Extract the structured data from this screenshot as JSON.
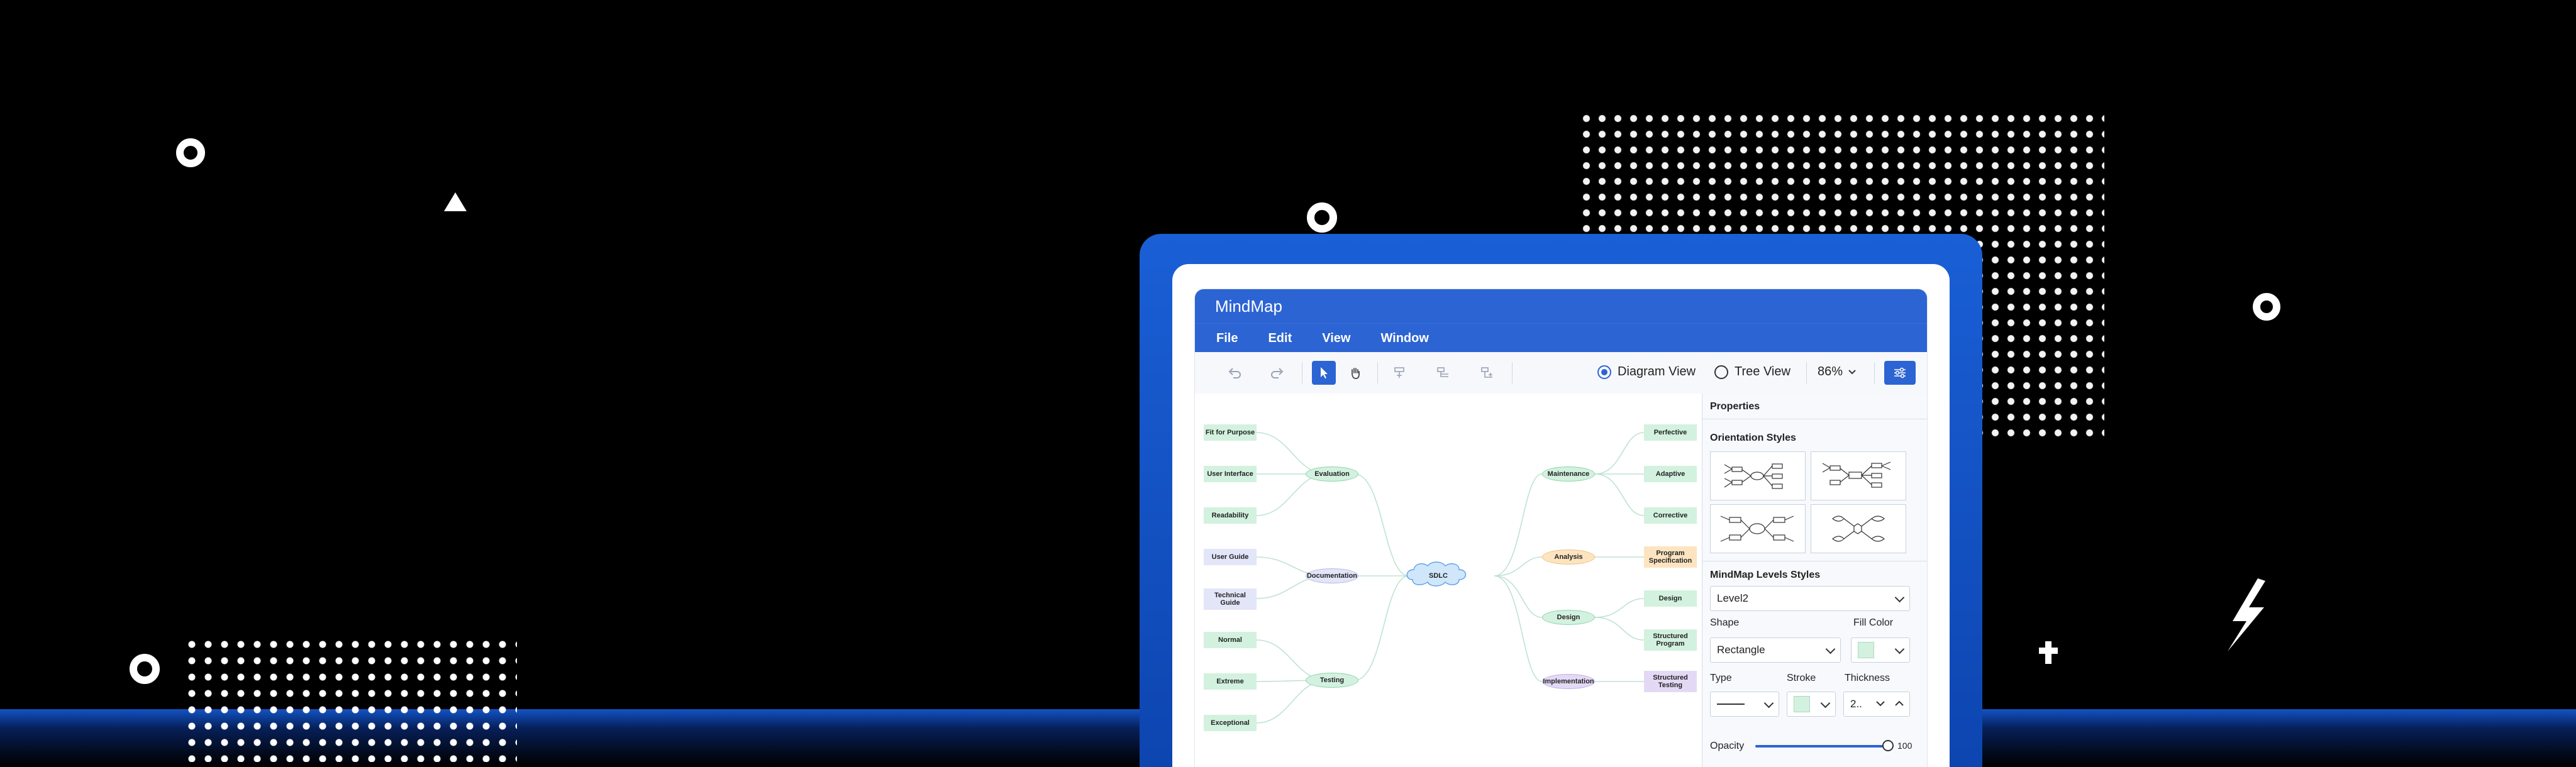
{
  "app": {
    "title": "MindMap",
    "menu": [
      "File",
      "Edit",
      "View",
      "Window"
    ]
  },
  "toolbar": {
    "diagram_view_label": "Diagram View",
    "tree_view_label": "Tree View",
    "selected_view": "Diagram View",
    "zoom": "86%"
  },
  "mindmap": {
    "root": "SDLC",
    "left_branches": [
      {
        "label": "Evaluation",
        "children": [
          "Fit for Purpose",
          "User Interface",
          "Readability"
        ]
      },
      {
        "label": "Documentation",
        "children": [
          "User Guide",
          "Technical Guide"
        ]
      },
      {
        "label": "Testing",
        "children": [
          "Normal",
          "Extreme",
          "Exceptional"
        ]
      }
    ],
    "right_branches": [
      {
        "label": "Maintenance",
        "children": [
          "Perfective",
          "Adaptive",
          "Corrective"
        ]
      },
      {
        "label": "Analysis",
        "children": [
          "Program Specification"
        ]
      },
      {
        "label": "Design",
        "children": [
          "Design",
          "Structured Program"
        ]
      },
      {
        "label": "Implementation",
        "children": [
          "Structured Testing"
        ]
      }
    ],
    "colors": {
      "evaluation": "#d3f1df",
      "documentation": "#e3e5f8",
      "testing": "#d3f1df",
      "maintenance": "#d3f1df",
      "analysis": "#fde4c1",
      "design": "#d3f1df",
      "implementation": "#e4d9f5",
      "root": "#cfe6fb"
    }
  },
  "properties": {
    "title": "Properties",
    "orientation_title": "Orientation Styles",
    "levels_title": "MindMap Levels Styles",
    "level_value": "Level2",
    "shape_label": "Shape",
    "shape_value": "Rectangle",
    "fill_label": "Fill Color",
    "fill_color": "#d3f1df",
    "type_label": "Type",
    "stroke_label": "Stroke",
    "stroke_color": "#d3f1df",
    "thickness_label": "Thickness",
    "thickness_value": "2..",
    "opacity_label": "Opacity",
    "opacity_value": "100"
  }
}
